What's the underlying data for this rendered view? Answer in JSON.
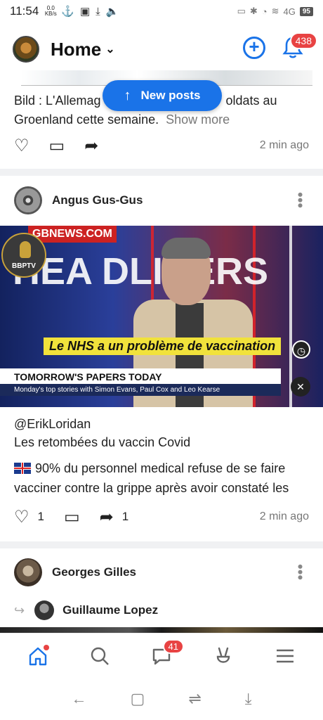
{
  "status_bar": {
    "time": "11:54",
    "net_speed": "0.0 KB/s",
    "battery": "95",
    "signal": "4G"
  },
  "header": {
    "title": "Home",
    "notifications_count": "438"
  },
  "new_posts_label": "New posts",
  "post1": {
    "caption": "Bild : L'Allemagne envoie des soldats au Groenland cette semaine.",
    "caption_visible_left": "Bild : L'Allemag",
    "caption_visible_right": "oldats au",
    "caption_line2": "Groenland cette semaine.",
    "show_more": "Show more",
    "time_ago": "2 min ago"
  },
  "post2": {
    "author": "Angus Gus-Gus",
    "video": {
      "channel_logo": "BBPTV",
      "gb_news": "GBNEWS.COM",
      "big_text": "HEA DLINERS",
      "subtitle": "Le NHS a un problème de vaccination",
      "ticker_title": "TOMORROW'S PAPERS TODAY",
      "ticker_sub": "Monday's top stories with Simon Evans, Paul Cox and Leo Kearse"
    },
    "mention": "@ErikLoridan",
    "line2": "Les retombées du vaccin Covid",
    "body": "90% du personnel medical refuse de se faire vacciner contre la grippe après avoir constaté les",
    "likes": "1",
    "shares": "1",
    "time_ago": "2 min ago"
  },
  "post3": {
    "author": "Georges Gilles",
    "shared_from": "Guillaume Lopez"
  },
  "bottom_nav": {
    "messages_badge": "41"
  },
  "colors": {
    "accent": "#1a73e8",
    "badge": "#e84343",
    "subtitle_bg": "#f1e23b"
  }
}
